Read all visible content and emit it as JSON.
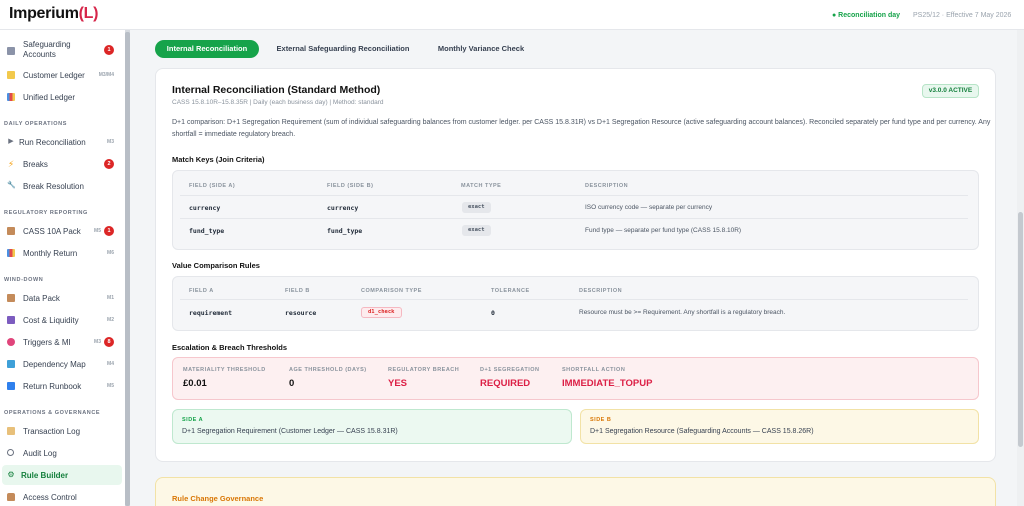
{
  "app": {
    "logo_text": "Imperium",
    "logo_mark": "(L)",
    "status": "● Reconciliation day",
    "policy": "PS25/12 · Effective 7 May 2026"
  },
  "sidebar": {
    "items": [
      {
        "label": "Safeguarding",
        "label2": "Accounts",
        "badge": "1",
        "icon": "bank-icon"
      },
      {
        "label": "Customer Ledger",
        "code": "M3/M4",
        "icon": "ledger-icon"
      },
      {
        "label": "Unified Ledger",
        "icon": "chart-icon"
      },
      {
        "section": "DAILY OPERATIONS"
      },
      {
        "label": "Run Reconciliation",
        "code": "M3",
        "icon": "play-icon"
      },
      {
        "label": "Breaks",
        "badge": "2",
        "icon": "bolt-icon"
      },
      {
        "label": "Break Resolution",
        "icon": "wrench-icon"
      },
      {
        "section": "REGULATORY REPORTING"
      },
      {
        "label": "CASS 10A Pack",
        "code": "M5",
        "badge": "1",
        "icon": "clipboard-icon"
      },
      {
        "label": "Monthly Return",
        "code": "M6",
        "icon": "chart-icon"
      },
      {
        "section": "WIND-DOWN"
      },
      {
        "label": "Data Pack",
        "code": "M1",
        "icon": "box-icon"
      },
      {
        "label": "Cost & Liquidity",
        "code": "M2",
        "icon": "money-icon"
      },
      {
        "label": "Triggers & MI",
        "code": "M3",
        "badge": "8",
        "icon": "alarm-icon"
      },
      {
        "label": "Dependency Map",
        "code": "M4",
        "icon": "map-icon"
      },
      {
        "label": "Return Runbook",
        "code": "M5",
        "icon": "book-icon"
      },
      {
        "section": "OPERATIONS & GOVERNANCE"
      },
      {
        "label": "Transaction Log",
        "icon": "scroll-icon"
      },
      {
        "label": "Audit Log",
        "icon": "search-icon"
      },
      {
        "label": "Rule Builder",
        "icon": "gear-icon",
        "active": true
      },
      {
        "label": "Access Control",
        "icon": "lock-icon"
      }
    ]
  },
  "tabs": [
    "Internal Reconciliation",
    "External Safeguarding Reconciliation",
    "Monthly Variance Check"
  ],
  "rule": {
    "title": "Internal Reconciliation (Standard Method)",
    "meta": "CASS 15.8.10R–15.8.35R | Daily (each business day) | Method: standard",
    "version": "v3.0.0 ACTIVE",
    "description": "D+1 comparison: D+1 Segregation Requirement (sum of individual safeguarding balances from customer ledger. per CASS 15.8.31R) vs D+1 Segregation Resource (active safeguarding account balances). Reconciled separately per fund type and per currency. Any shortfall = immediate regulatory breach."
  },
  "match_keys": {
    "title": "Match Keys (Join Criteria)",
    "headers": [
      "FIELD (SIDE A)",
      "FIELD (SIDE B)",
      "MATCH TYPE",
      "DESCRIPTION"
    ],
    "rows": [
      {
        "a": "currency",
        "b": "currency",
        "type": "exact",
        "desc": "ISO currency code — separate per currency"
      },
      {
        "a": "fund_type",
        "b": "fund_type",
        "type": "exact",
        "desc": "Fund type — separate per fund type (CASS 15.8.10R)"
      }
    ]
  },
  "value_rules": {
    "title": "Value Comparison Rules",
    "headers": [
      "FIELD A",
      "FIELD B",
      "COMPARISON TYPE",
      "TOLERANCE",
      "DESCRIPTION"
    ],
    "rows": [
      {
        "a": "requirement",
        "b": "resource",
        "type": "d1_check",
        "tolerance": "0",
        "desc": "Resource must be >= Requirement. Any shortfall is a regulatory breach."
      }
    ]
  },
  "escalation": {
    "title": "Escalation & Breach Thresholds",
    "items": [
      {
        "label": "MATERIALITY THRESHOLD",
        "value": "£0.01"
      },
      {
        "label": "AGE THRESHOLD (DAYS)",
        "value": "0"
      },
      {
        "label": "REGULATORY BREACH",
        "value": "YES"
      },
      {
        "label": "D+1 SEGREGATION",
        "value": "REQUIRED"
      },
      {
        "label": "SHORTFALL ACTION",
        "value": "IMMEDIATE_TOPUP"
      }
    ]
  },
  "sides": {
    "a_label": "SIDE A",
    "a_value": "D+1 Segregation Requirement (Customer Ledger — CASS 15.8.31R)",
    "b_label": "SIDE B",
    "b_value": "D+1 Segregation Resource (Safeguarding Accounts — CASS 15.8.26R)"
  },
  "governance": {
    "title": "Rule Change Governance"
  },
  "colors": {
    "accent": "#16a34a",
    "danger": "#dc2626",
    "warning": "#d97706"
  }
}
